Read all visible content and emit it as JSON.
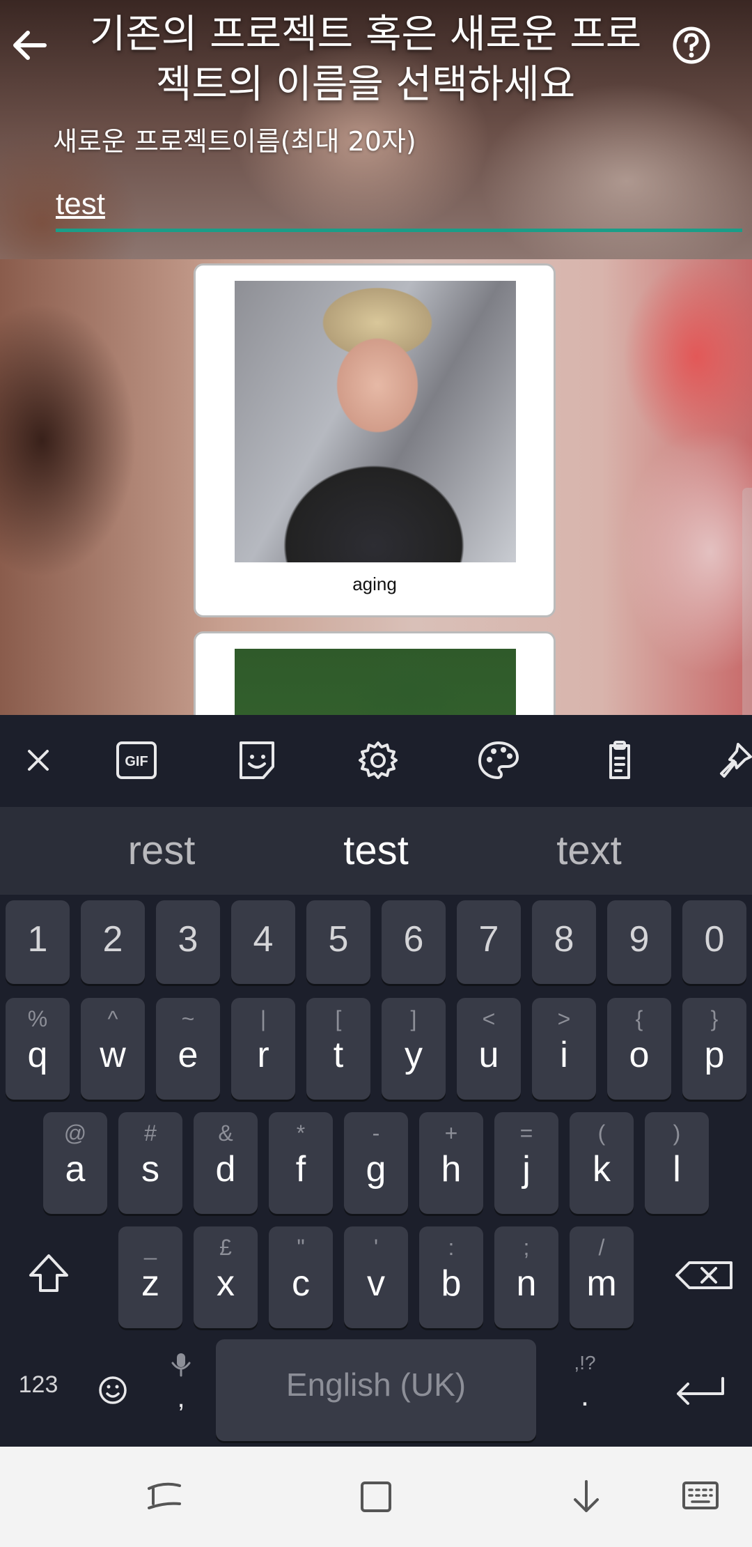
{
  "header": {
    "title": "기존의 프로젝트 혹은 새로운 프로젝트의 이름을 선택하세요",
    "back_icon": "arrow-left-icon",
    "help_icon": "help-circle-icon"
  },
  "new_project": {
    "label": "새로운 프로젝트이름(최대 20자)",
    "value": "test",
    "accent_color": "#1a9e88"
  },
  "projects": [
    {
      "label": "aging"
    },
    {
      "label": ""
    }
  ],
  "keyboard": {
    "toolbar": [
      "close-icon",
      "gif-icon",
      "sticker-icon",
      "settings-icon",
      "theme-palette-icon",
      "clipboard-icon",
      "pin-icon"
    ],
    "gif_label": "GIF",
    "suggestions": [
      "rest",
      "test",
      "text"
    ],
    "number_row": [
      "1",
      "2",
      "3",
      "4",
      "5",
      "6",
      "7",
      "8",
      "9",
      "0"
    ],
    "row1": [
      {
        "key": "q",
        "alt": "%"
      },
      {
        "key": "w",
        "alt": "^"
      },
      {
        "key": "e",
        "alt": "~"
      },
      {
        "key": "r",
        "alt": "|"
      },
      {
        "key": "t",
        "alt": "["
      },
      {
        "key": "y",
        "alt": "]"
      },
      {
        "key": "u",
        "alt": "<"
      },
      {
        "key": "i",
        "alt": ">"
      },
      {
        "key": "o",
        "alt": "{"
      },
      {
        "key": "p",
        "alt": "}"
      }
    ],
    "row2": [
      {
        "key": "a",
        "alt": "@"
      },
      {
        "key": "s",
        "alt": "#"
      },
      {
        "key": "d",
        "alt": "&"
      },
      {
        "key": "f",
        "alt": "*"
      },
      {
        "key": "g",
        "alt": "-"
      },
      {
        "key": "h",
        "alt": "+"
      },
      {
        "key": "j",
        "alt": "="
      },
      {
        "key": "k",
        "alt": "("
      },
      {
        "key": "l",
        "alt": ")"
      }
    ],
    "row3": [
      {
        "key": "z",
        "alt": "_"
      },
      {
        "key": "x",
        "alt": "£"
      },
      {
        "key": "c",
        "alt": "\""
      },
      {
        "key": "v",
        "alt": "'"
      },
      {
        "key": "b",
        "alt": ":"
      },
      {
        "key": "n",
        "alt": ";"
      },
      {
        "key": "m",
        "alt": "/"
      }
    ],
    "bottom": {
      "symbols_label": "123",
      "comma": ",",
      "space_label": "English (UK)",
      "period": ".",
      "period_alt": ",!?"
    }
  },
  "navbar": [
    "recent-apps-icon",
    "home-icon",
    "hide-keyboard-icon",
    "keyboard-switch-icon"
  ]
}
